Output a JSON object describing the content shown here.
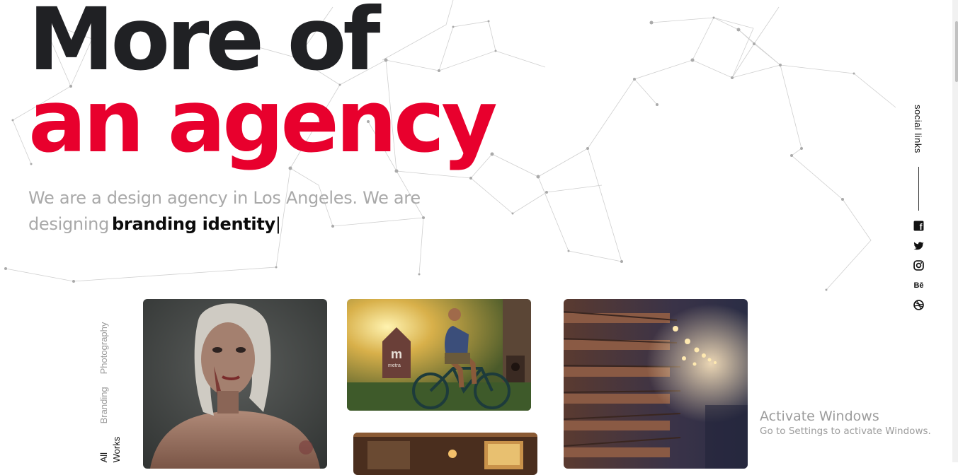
{
  "hero": {
    "title_line1": "More of",
    "title_line2": "an agency",
    "tagline": "We are a design agency in Los Angeles. We are designing",
    "typed_word": "branding identity",
    "cursor": "|"
  },
  "social": {
    "label": "social links",
    "icons": [
      "facebook-icon",
      "twitter-icon",
      "instagram-icon",
      "behance-icon",
      "dribbble-icon"
    ],
    "behance_text": "Bē",
    "facebook_text": "f"
  },
  "filters": [
    "All Works",
    "Branding",
    "Photography"
  ],
  "portfolio": {
    "card2_sign_letter": "m",
    "card2_sign_word": "metra"
  },
  "windows_notice": {
    "title": "Activate Windows",
    "subtitle": "Go to Settings to activate Windows."
  },
  "colors": {
    "accent": "#e8002d",
    "dark": "#202124",
    "muted": "#a9a9a9"
  }
}
